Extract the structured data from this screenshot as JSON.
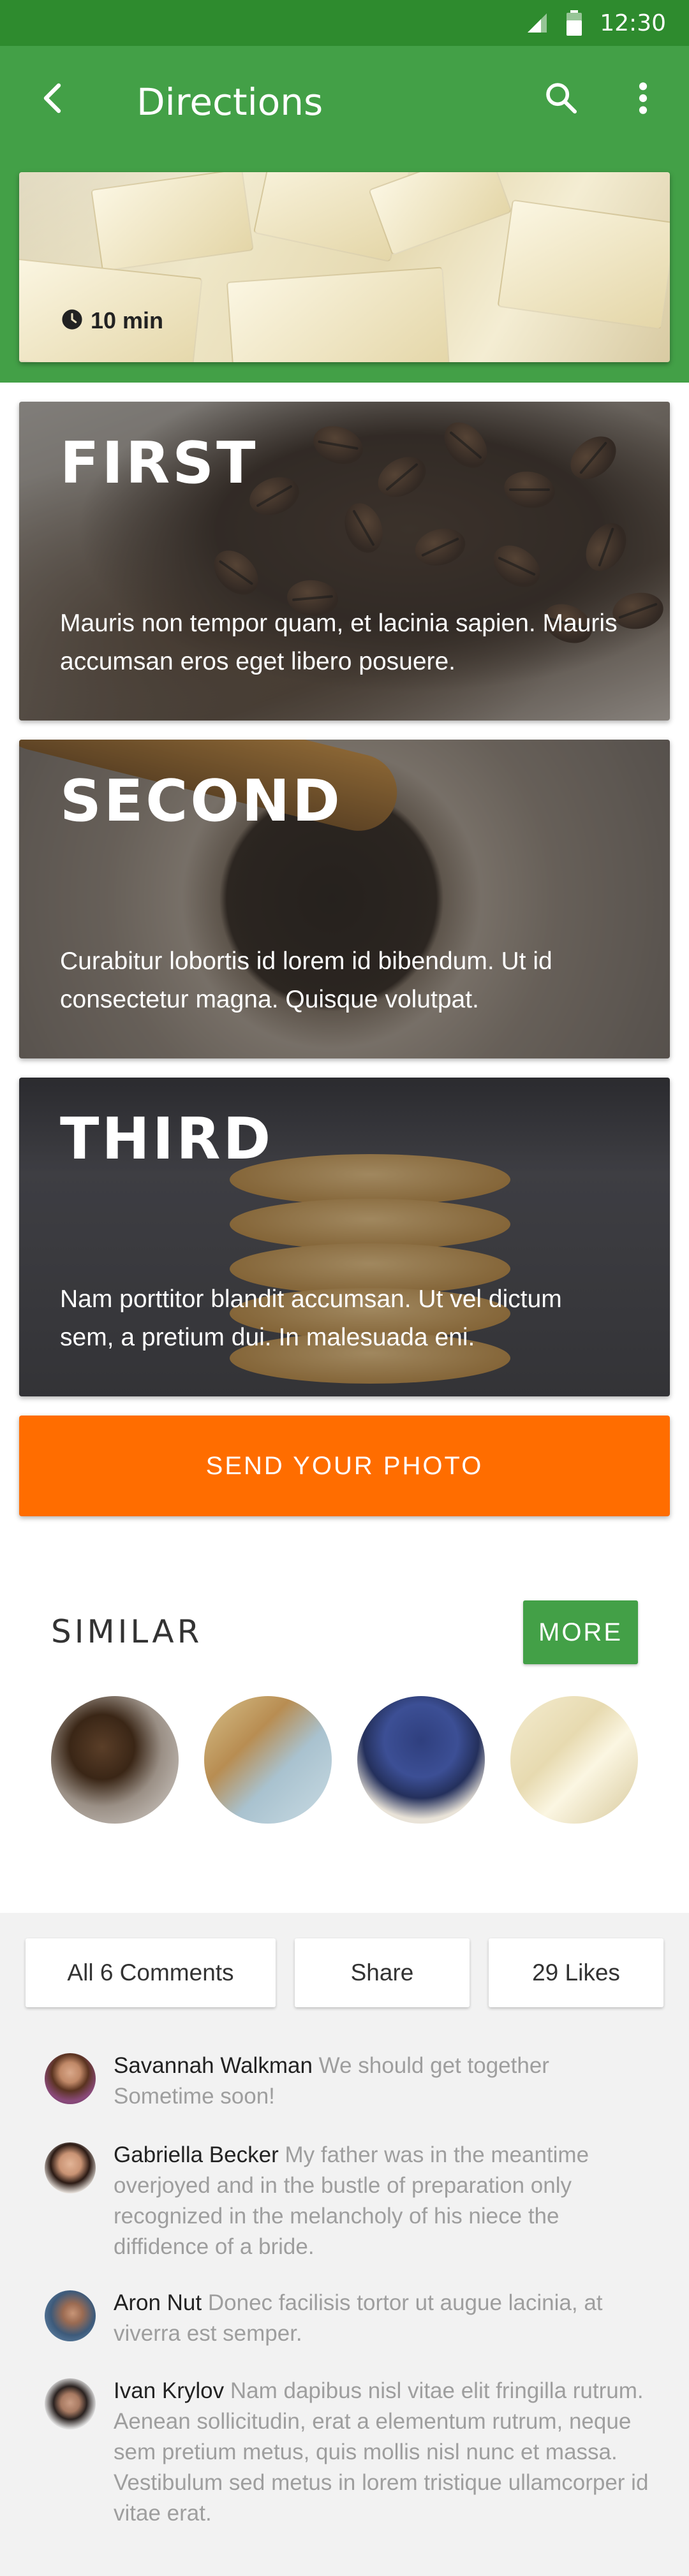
{
  "status_bar": {
    "time": "12:30",
    "icons": [
      "signal-icon",
      "battery-icon"
    ]
  },
  "toolbar": {
    "title": "Directions",
    "back_icon": "arrow-back-icon",
    "search_icon": "search-icon",
    "more_icon": "more-vert-icon"
  },
  "hero": {
    "time_label": "10 min",
    "time_icon": "clock-icon"
  },
  "steps": [
    {
      "title": "FIRST",
      "text": "Mauris non tempor quam, et lacinia sapien. Mauris accumsan eros eget libero posuere."
    },
    {
      "title": "SECOND",
      "text": "Curabitur lobortis id lorem id bibendum. Ut id consectetur magna. Quisque volutpat."
    },
    {
      "title": "THIRD",
      "text": "Nam porttitor blandit accumsan. Ut vel dictum sem, a pretium dui. In malesuada eni."
    }
  ],
  "send_photo": {
    "label": "SEND YOUR PHOTO"
  },
  "similar": {
    "title": "SIMILAR",
    "more_label": "MORE"
  },
  "actions": {
    "comments_label": "All 6 Comments",
    "share_label": "Share",
    "likes_label": "29 Likes"
  },
  "comments": [
    {
      "name": "Savannah Walkman",
      "text": "We should get together Sometime soon!"
    },
    {
      "name": "Gabriella Becker",
      "text": "My father was in the meantime overjoyed and in the bustle of preparation only recognized in the melancholy of his niece the diffidence of a bride."
    },
    {
      "name": "Aron Nut",
      "text": "Donec facilisis tortor ut augue lacinia, at viverra est semper."
    },
    {
      "name": "Ivan Krylov",
      "text": "Nam dapibus nisl vitae elit fringilla rutrum. Aenean sollicitudin, erat a elementum rutrum, neque sem pretium metus, quis mollis nisl nunc et massa. Vestibulum sed metus in lorem tristique ullamcorper id vitae erat."
    }
  ],
  "colors": {
    "primary": "#43a047",
    "primary_dark": "#2e8b2e",
    "accent": "#ff6d00"
  }
}
